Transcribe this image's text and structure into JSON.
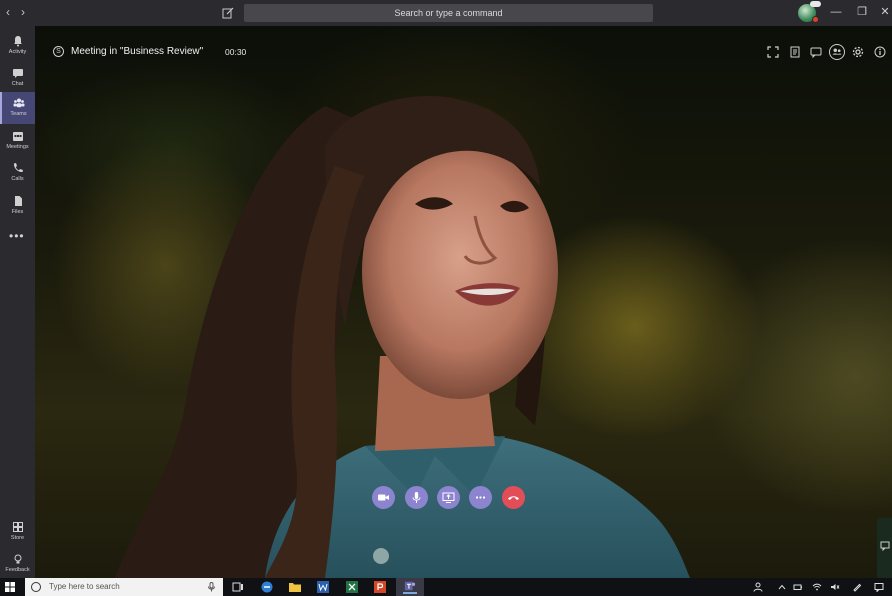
{
  "titlebar": {
    "search_placeholder": "Search or type a command",
    "back_glyph": "‹",
    "forward_glyph": "›",
    "minimize_glyph": "—",
    "restore_glyph": "❐",
    "close_glyph": "✕"
  },
  "rail": {
    "items": [
      {
        "label": "Activity",
        "icon": "bell-icon"
      },
      {
        "label": "Chat",
        "icon": "chat-icon"
      },
      {
        "label": "Teams",
        "icon": "teams-icon",
        "active": true
      },
      {
        "label": "Meetings",
        "icon": "calendar-icon"
      },
      {
        "label": "Calls",
        "icon": "phone-icon"
      },
      {
        "label": "Files",
        "icon": "file-icon"
      }
    ],
    "more_glyph": "•••",
    "bottom": [
      {
        "label": "Store",
        "icon": "store-icon"
      },
      {
        "label": "Feedback",
        "icon": "lightbulb-icon"
      }
    ]
  },
  "meeting": {
    "title": "Meeting in \"Business Review\"",
    "timer": "00:30"
  },
  "controls": [
    "video-icon",
    "mic-icon",
    "share-screen-icon",
    "more-icon",
    "hangup-icon"
  ],
  "taskbar": {
    "search_placeholder": "Type here to search"
  },
  "colors": {
    "rail_bg": "#2b2b2f",
    "active_rail": "#464775",
    "control_purple": "#8c84cf",
    "hangup_red": "#e14e58"
  }
}
